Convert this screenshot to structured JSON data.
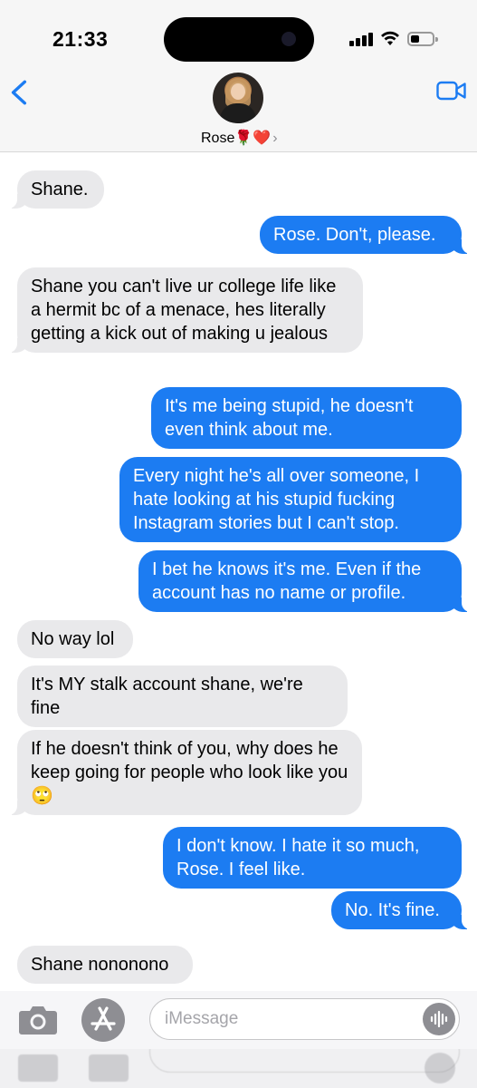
{
  "status_bar": {
    "time": "21:33"
  },
  "header": {
    "contact_name": "Rose🌹❤️",
    "chevron": "›",
    "back_icon": "chevron-left-icon",
    "video_icon": "video-camera-icon",
    "accent_color": "#1c7cf2"
  },
  "messages": [
    {
      "direction": "incoming",
      "text": "Shane."
    },
    {
      "direction": "outgoing",
      "text": "Rose. Don't, please."
    },
    {
      "direction": "incoming",
      "text": "Shane you can't live ur college life like a hermit bc of a menace, hes literally getting a kick out of making u jealous"
    },
    {
      "direction": "outgoing",
      "text": "It's me being stupid, he doesn't even think about me."
    },
    {
      "direction": "outgoing",
      "text": "Every night he's all over someone, I hate looking at his stupid fucking Instagram stories but I can't stop."
    },
    {
      "direction": "outgoing",
      "text": "I bet he knows it's me. Even if the account has no name or profile."
    },
    {
      "direction": "incoming",
      "text": "No way lol"
    },
    {
      "direction": "incoming",
      "text": "It's MY stalk account shane, we're fine"
    },
    {
      "direction": "incoming",
      "text": "If he doesn't think of you, why does he keep going for people who look like you🙄"
    },
    {
      "direction": "outgoing",
      "text": "I don't know. I hate it so much, Rose. I feel like."
    },
    {
      "direction": "outgoing",
      "text": "No. It's fine."
    },
    {
      "direction": "incoming",
      "text": "Shane nononono"
    }
  ],
  "composer": {
    "placeholder": "iMessage",
    "camera_icon": "camera-icon",
    "apps_icon": "app-store-icon",
    "mic_icon": "audio-waveform-icon"
  },
  "colors": {
    "incoming_bubble": "#e9e9eb",
    "outgoing_bubble": "#1c7cf2"
  }
}
